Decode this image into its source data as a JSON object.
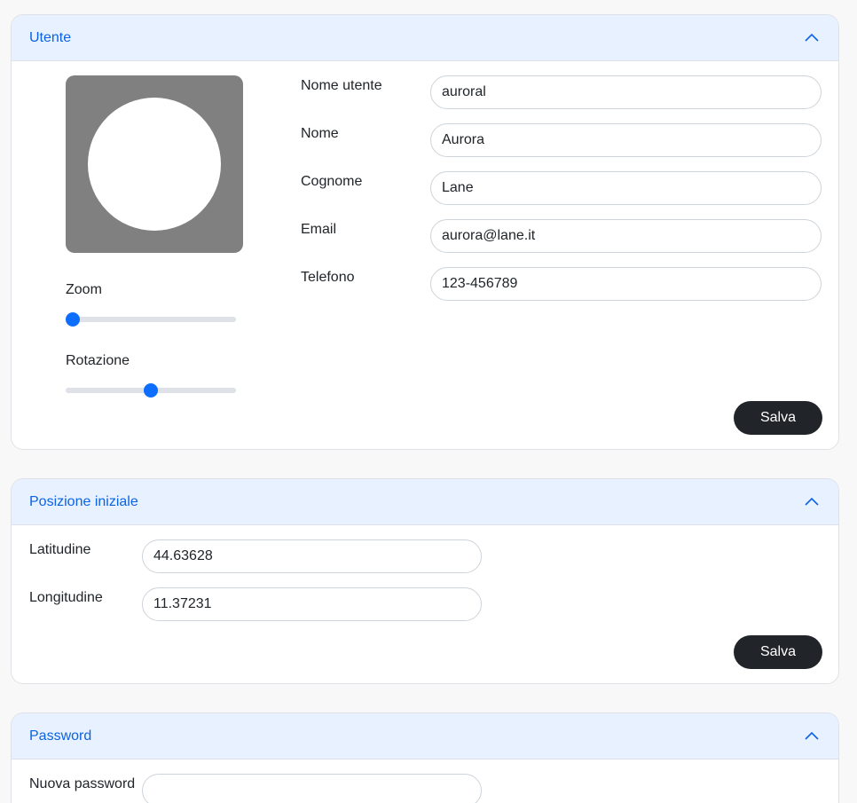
{
  "user_section": {
    "title": "Utente",
    "fields": [
      {
        "label": "Nome utente",
        "value": "auroral"
      },
      {
        "label": "Nome",
        "value": "Aurora"
      },
      {
        "label": "Cognome",
        "value": "Lane"
      },
      {
        "label": "Email",
        "value": "aurora@lane.it"
      },
      {
        "label": "Telefono",
        "value": "123-456789"
      }
    ],
    "avatar_editor": {
      "zoom_label": "Zoom",
      "zoom_level": 0.0,
      "rotation_label": "Rotazione",
      "rotation_level": 0.5
    },
    "save_label": "Salva"
  },
  "position_section": {
    "title": "Posizione iniziale",
    "fields": [
      {
        "label": "Latitudine",
        "value": "44.63628"
      },
      {
        "label": "Longitudine",
        "value": "11.37231"
      }
    ],
    "save_label": "Salva"
  },
  "password_section": {
    "title": "Password",
    "new_password_label": "Nuova password",
    "new_password_value": ""
  },
  "colors": {
    "accent": "#0d6efd",
    "header_bg": "#e7f1ff",
    "header_text": "#0c63e4",
    "button_dark": "#212529",
    "avatar_bg": "#808080"
  },
  "icons": {
    "collapse": "chevron-up-icon"
  }
}
